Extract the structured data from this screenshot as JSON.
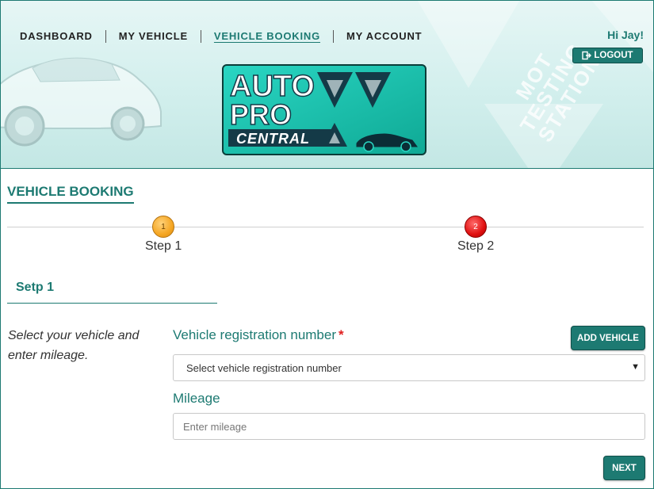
{
  "nav": {
    "items": [
      {
        "label": "DASHBOARD"
      },
      {
        "label": "MY VEHICLE"
      },
      {
        "label": "VEHICLE BOOKING"
      },
      {
        "label": "MY ACCOUNT"
      }
    ],
    "active_index": 2
  },
  "header": {
    "greeting": "Hi Jay!",
    "logout_label": "LOGOUT",
    "logout_icon": "sign-out-icon",
    "watermark_lines": [
      "MOT",
      "TESTING",
      "STATION"
    ],
    "logo": {
      "line1": "AUTO",
      "line2": "PRO",
      "line3": "CENTRAL"
    }
  },
  "page": {
    "title": "VEHICLE BOOKING"
  },
  "steps": [
    {
      "number": "1",
      "label": "Step 1",
      "color": "#f5a623"
    },
    {
      "number": "2",
      "label": "Step 2",
      "color": "#e01010"
    }
  ],
  "section": {
    "title": "Setp 1",
    "help_text": "Select your vehicle and enter mileage."
  },
  "form": {
    "registration_label": "Vehicle registration number",
    "required_mark": "*",
    "registration_select_value": "Select vehicle registration number",
    "add_vehicle_label": "ADD VEHICLE",
    "mileage_label": "Mileage",
    "mileage_placeholder": "Enter mileage",
    "next_label": "NEXT"
  },
  "colors": {
    "accent": "#1d7a72",
    "required": "#e02020"
  }
}
